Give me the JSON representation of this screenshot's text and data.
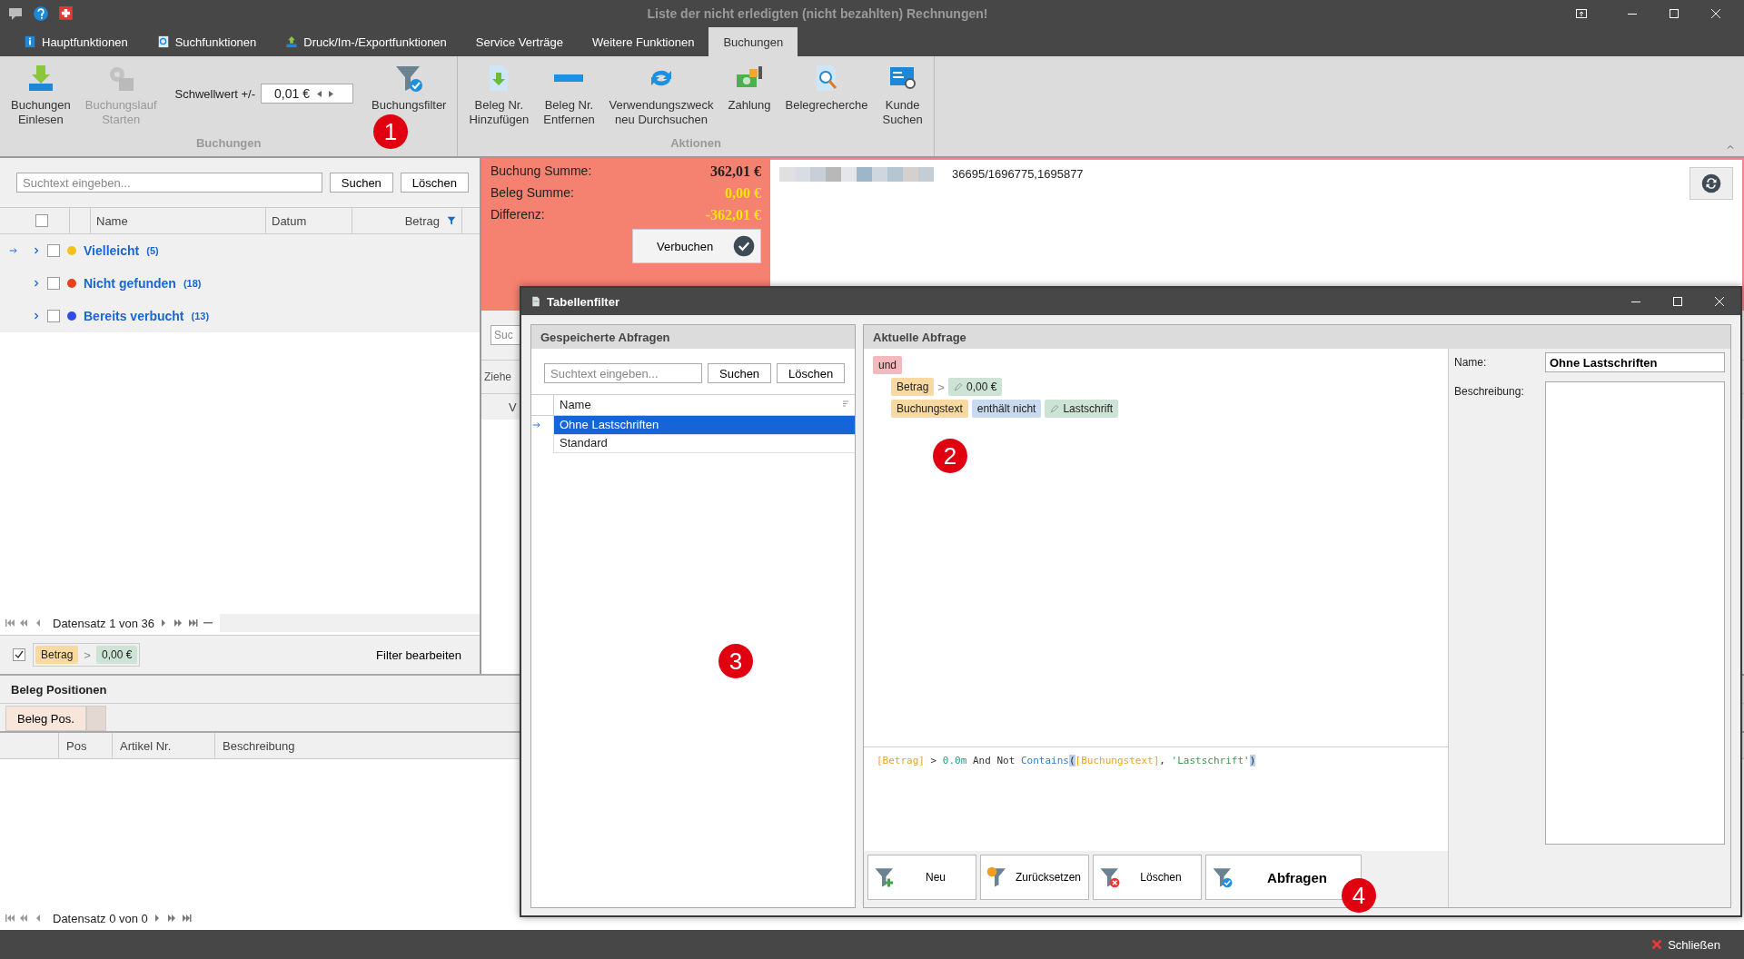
{
  "window": {
    "title": "Liste der nicht erledigten (nicht bezahlten) Rechnungen!"
  },
  "ribbon_tabs": [
    {
      "label": "Hauptfunktionen",
      "selected": false
    },
    {
      "label": "Suchfunktionen",
      "selected": false
    },
    {
      "label": "Druck/Im-/Exportfunktionen",
      "selected": false
    },
    {
      "label": "Service Verträge",
      "selected": false
    },
    {
      "label": "Weitere Funktionen",
      "selected": false
    },
    {
      "label": "Buchungen",
      "selected": true
    }
  ],
  "ribbon_groups": [
    {
      "title": "Buchungen",
      "buttons": [
        {
          "label": "Buchungen\nEinlesen",
          "disabled": false
        },
        {
          "label": "Buchungslauf\nStarten",
          "disabled": true
        }
      ],
      "threshold": {
        "label": "Schwellwert +/-",
        "value": "0,01 €"
      },
      "extra_buttons": [
        {
          "label": "Buchungsfilter",
          "disabled": false
        }
      ]
    },
    {
      "title": "Aktionen",
      "buttons": [
        {
          "label": "Beleg Nr.\nHinzufügen",
          "disabled": false
        },
        {
          "label": "Beleg Nr.\nEntfernen",
          "disabled": false
        },
        {
          "label": "Verwendungszweck\nneu Durchsuchen",
          "disabled": false
        },
        {
          "label": "Zahlung",
          "disabled": false
        },
        {
          "label": "Belegrecherche",
          "disabled": false
        },
        {
          "label": "Kunde\nSuchen",
          "disabled": false
        }
      ]
    }
  ],
  "search": {
    "placeholder": "Suchtext eingeben...",
    "buttons": [
      "Suchen",
      "Löschen"
    ]
  },
  "grid": {
    "select_all_checked": false,
    "columns": [
      "Name",
      "Datum",
      "Betrag"
    ],
    "groups": [
      {
        "name": "Vielleicht",
        "count": "(5)",
        "color": "#f2c21b",
        "selected": true,
        "checked": false,
        "expanded": false
      },
      {
        "name": "Nicht gefunden",
        "count": "(18)",
        "color": "#e8401c",
        "selected": false,
        "checked": false,
        "expanded": false
      },
      {
        "name": "Bereits verbucht",
        "count": "(13)",
        "color": "#2f4de6",
        "selected": false,
        "checked": false,
        "expanded": false
      }
    ],
    "pager": "Datensatz 1 von 36"
  },
  "filter_bar": {
    "checked": true,
    "field": "Betrag",
    "operator": ">",
    "value": "0,00 €",
    "edit_link": "Filter bearbeiten"
  },
  "summary": {
    "rows": [
      {
        "label": "Buchung Summe:",
        "value": "362,01 €",
        "kind": "normal"
      },
      {
        "label": "Beleg Summe:",
        "value": "0,00 €",
        "kind": "highlight"
      },
      {
        "label": "Differenz:",
        "value": "-362,01 €",
        "kind": "highlight"
      }
    ],
    "button": "Verbuchen"
  },
  "info": {
    "text": "36695/1696775,1695877"
  },
  "middle_panel": {
    "search_placeholder": "Suc",
    "group_hint": "Ziehe",
    "column_1": "V"
  },
  "positions": {
    "title": "Beleg Positionen",
    "tabs": [
      {
        "label": "Beleg Pos.",
        "selected": true
      }
    ],
    "columns": [
      "Pos",
      "Artikel Nr.",
      "Beschreibung"
    ],
    "pager": "Datensatz 0 von 0"
  },
  "dialog": {
    "title": "Tabellenfilter",
    "saved": {
      "title": "Gespeicherte Abfragen",
      "placeholder": "Suchtext eingeben...",
      "buttons": [
        "Suchen",
        "Löschen"
      ],
      "column": "Name",
      "rows": [
        {
          "name": "Ohne Lastschriften",
          "selected": true
        },
        {
          "name": "Standard",
          "selected": false
        }
      ]
    },
    "current": {
      "title": "Aktuelle Abfrage",
      "group": "und",
      "conditions": [
        {
          "field": "Betrag",
          "operator": ">",
          "value": "0,00 €"
        },
        {
          "field": "Buchungstext",
          "operator": "enthält nicht",
          "value": "Lastschrift"
        }
      ],
      "expression": [
        {
          "text": "[Betrag]",
          "kind": "field"
        },
        {
          "text": " > ",
          "kind": "plain"
        },
        {
          "text": "0.0m",
          "kind": "number"
        },
        {
          "text": " And Not ",
          "kind": "plain"
        },
        {
          "text": "Contains",
          "kind": "function"
        },
        {
          "text": "(",
          "kind": "bracket"
        },
        {
          "text": "[Buchungstext]",
          "kind": "field"
        },
        {
          "text": ", ",
          "kind": "plain"
        },
        {
          "text": "'Lastschrift'",
          "kind": "string"
        },
        {
          "text": ")",
          "kind": "bracket"
        }
      ],
      "name_label": "Name:",
      "name_value": "Ohne Lastschriften",
      "description_label": "Beschreibung:"
    },
    "buttons": [
      {
        "label": "Neu",
        "primary": false
      },
      {
        "label": "Zurücksetzen",
        "primary": false
      },
      {
        "label": "Löschen",
        "primary": false
      },
      {
        "label": "Abfragen",
        "primary": true
      }
    ]
  },
  "callouts": [
    {
      "label": "1"
    },
    {
      "label": "2"
    },
    {
      "label": "3"
    },
    {
      "label": "4"
    }
  ],
  "status_bar": {
    "close": "Schließen"
  }
}
